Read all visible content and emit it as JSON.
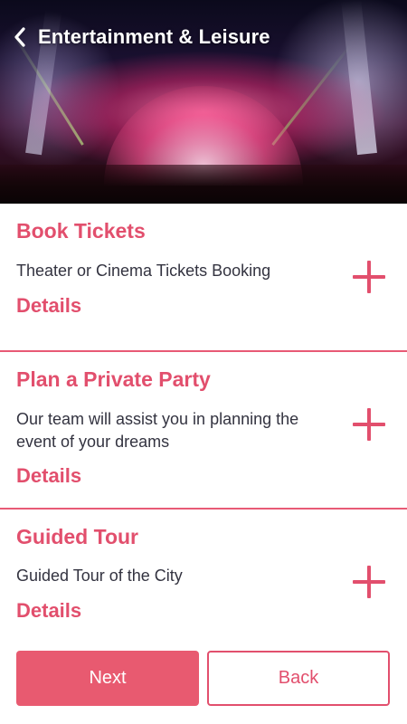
{
  "header": {
    "title": "Entertainment & Leisure",
    "back_icon": "chevron-left-icon"
  },
  "hero": {
    "image": "concert-stage-photo"
  },
  "services": [
    {
      "title": "Book Tickets",
      "description": "Theater or Cinema Tickets Booking",
      "details_label": "Details",
      "action_icon": "plus-icon"
    },
    {
      "title": "Plan a Private Party",
      "description": "Our team will assist you in planning the event of your dreams",
      "details_label": "Details",
      "action_icon": "plus-icon"
    },
    {
      "title": "Guided Tour",
      "description": "Guided Tour of the City",
      "details_label": "Details",
      "action_icon": "plus-icon"
    }
  ],
  "footer": {
    "next_label": "Next",
    "back_label": "Back"
  },
  "colors": {
    "accent": "#e24f6d",
    "button_fill": "#e85a70",
    "text": "#333340"
  }
}
